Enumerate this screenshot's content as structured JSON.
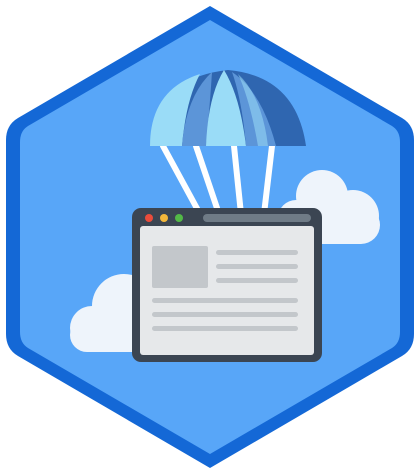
{
  "badge": {
    "icon": "parachute-delivering-browser-window",
    "colors": {
      "hex_border": "#1468d6",
      "hex_fill": "#58a6f8",
      "cloud": "#eef4fb",
      "cloud_shadow": "#c9dff5",
      "canopy_light": "#9adcf7",
      "canopy_mid": "#5c95d8",
      "canopy_dark": "#2f66b0",
      "strings": "#ffffff",
      "window_frame": "#3b4552",
      "window_page": "#e6e8ea",
      "window_lines": "#c3c7cb",
      "dot_red": "#ea4c3b",
      "dot_yellow": "#f3b73a",
      "dot_green": "#53b947",
      "address_bar": "#6f7b86"
    }
  }
}
